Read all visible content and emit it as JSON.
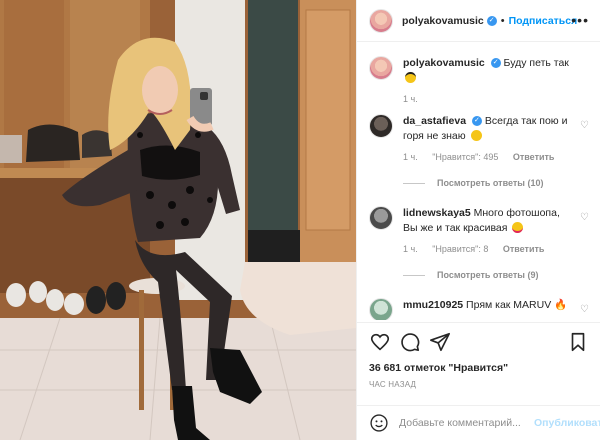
{
  "post": {
    "username": "polyakovamusic",
    "follow_label": "Подписаться",
    "more_label": "•••",
    "dot": "•",
    "caption": "Буду петь так",
    "caption_time": "1 ч."
  },
  "comments": [
    {
      "username": "da_astafieva",
      "verified": true,
      "text": "Всегда так пою и горя не знаю",
      "time": "1 ч.",
      "likes": "\"Нравится\": 495",
      "reply_label": "Ответить",
      "view_replies": "Посмотреть ответы (10)"
    },
    {
      "username": "lidnewskaya5",
      "verified": false,
      "text": "Много фотошопа, Вы же и так красивая",
      "time": "1 ч.",
      "likes": "\"Нравится\": 8",
      "reply_label": "Ответить",
      "view_replies": "Посмотреть ответы (9)"
    },
    {
      "username": "mmu210925",
      "verified": false,
      "text": "Прям как MARUV"
    }
  ],
  "likes_count": "36 681 отметок \"Нравится\"",
  "posted_ago": "ЧАС НАЗАД",
  "comment_box": {
    "placeholder": "Добавьте комментарий...",
    "post_label": "Опубликовать"
  },
  "icons": [
    "heart-icon",
    "comment-icon",
    "share-icon",
    "bookmark-icon",
    "smile-icon",
    "verified-icon"
  ],
  "colors": {
    "link_blue": "#0095f6",
    "verified_blue": "#3897f0",
    "muted": "#8e8e8e",
    "post_disabled": "#b2dffc"
  }
}
